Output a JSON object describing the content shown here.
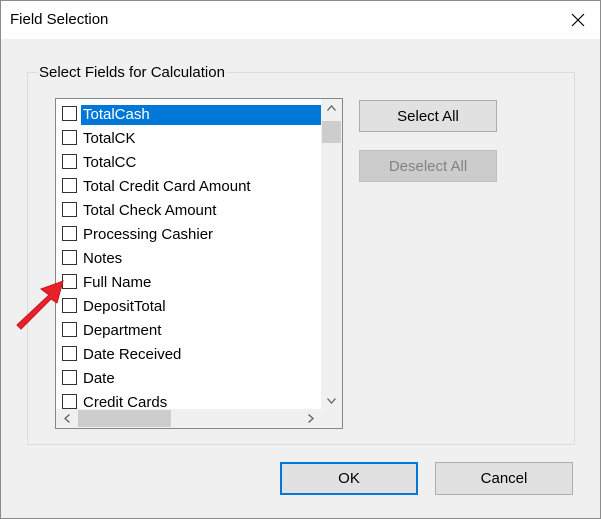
{
  "window": {
    "title": "Field Selection"
  },
  "group": {
    "label": "Select Fields for Calculation"
  },
  "fields": [
    {
      "label": "TotalCash",
      "checked": false,
      "selected": true
    },
    {
      "label": "TotalCK",
      "checked": false,
      "selected": false
    },
    {
      "label": "TotalCC",
      "checked": false,
      "selected": false
    },
    {
      "label": "Total Credit Card Amount",
      "checked": false,
      "selected": false
    },
    {
      "label": "Total Check Amount",
      "checked": false,
      "selected": false
    },
    {
      "label": "Processing Cashier",
      "checked": false,
      "selected": false
    },
    {
      "label": "Notes",
      "checked": false,
      "selected": false
    },
    {
      "label": "Full Name",
      "checked": false,
      "selected": false
    },
    {
      "label": "DepositTotal",
      "checked": false,
      "selected": false
    },
    {
      "label": "Department",
      "checked": false,
      "selected": false
    },
    {
      "label": "Date Received",
      "checked": false,
      "selected": false
    },
    {
      "label": "Date",
      "checked": false,
      "selected": false
    },
    {
      "label": "Credit Cards",
      "checked": false,
      "selected": false
    }
  ],
  "buttons": {
    "select_all": "Select All",
    "deselect_all": "Deselect All",
    "ok": "OK",
    "cancel": "Cancel"
  },
  "colors": {
    "selection": "#0078d7",
    "annotation_arrow": "#e8202a"
  },
  "icons": {
    "close": "close-icon",
    "annotation": "red-arrow-annotation-icon"
  }
}
